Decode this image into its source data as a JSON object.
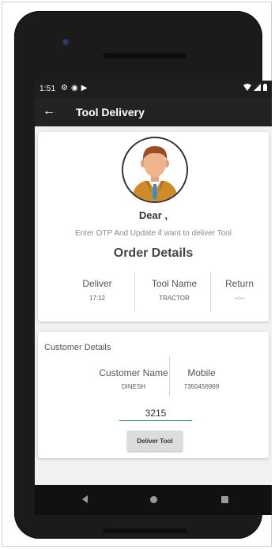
{
  "status_bar": {
    "time": "1:51",
    "icons": [
      "settings-icon",
      "circle-icon",
      "play-icon"
    ],
    "right_icons": [
      "wifi-icon",
      "signal-icon",
      "battery-icon"
    ]
  },
  "app_bar": {
    "title": "Tool Delivery",
    "back_icon": "arrow-back-icon"
  },
  "profile": {
    "greeting": "Dear ,",
    "instruction": "Enter OTP And Update if want to deliver Tool"
  },
  "order_details": {
    "title": "Order Details",
    "columns": [
      {
        "label": "Deliver",
        "value": "17:12"
      },
      {
        "label": "Tool Name",
        "value": "TRACTOR"
      },
      {
        "label": "Return",
        "value": "--:--"
      }
    ]
  },
  "customer_details": {
    "title": "Customer Details",
    "columns": [
      {
        "label": "Customer Name",
        "value": "DINESH"
      },
      {
        "label": "Mobile",
        "value": "7350456969"
      }
    ],
    "otp_value": "3215",
    "button_label": "Deliver Tool"
  },
  "nav_bar": {
    "icons": [
      "nav-back-icon",
      "nav-home-icon",
      "nav-recents-icon"
    ]
  },
  "colors": {
    "app_bar": "#232323",
    "input_underline": "#2e8b7a",
    "avatar_jacket": "#d08a2a",
    "avatar_tie": "#2a8fd6"
  }
}
